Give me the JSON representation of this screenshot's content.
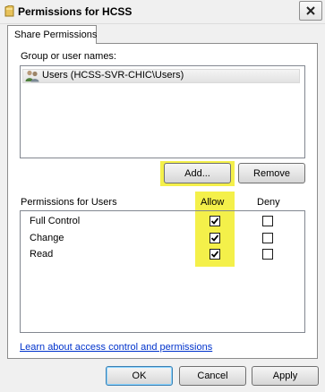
{
  "window": {
    "title": "Permissions for HCSS"
  },
  "tabs": [
    {
      "label": "Share Permissions",
      "active": true
    }
  ],
  "group_section": {
    "label": "Group or user names:",
    "items": [
      {
        "label": "Users (HCSS-SVR-CHIC\\Users)",
        "icon": "users-icon",
        "selected": true
      }
    ]
  },
  "buttons": {
    "add": "Add...",
    "remove": "Remove",
    "ok": "OK",
    "cancel": "Cancel",
    "apply": "Apply"
  },
  "permissions": {
    "label": "Permissions for Users",
    "allow_header": "Allow",
    "deny_header": "Deny",
    "rows": [
      {
        "name": "Full Control",
        "allow": true,
        "deny": false
      },
      {
        "name": "Change",
        "allow": true,
        "deny": false
      },
      {
        "name": "Read",
        "allow": true,
        "deny": false
      }
    ]
  },
  "link": {
    "text": "Learn about access control and permissions"
  },
  "colors": {
    "highlight": "#f4f04a",
    "link": "#0033cc"
  }
}
